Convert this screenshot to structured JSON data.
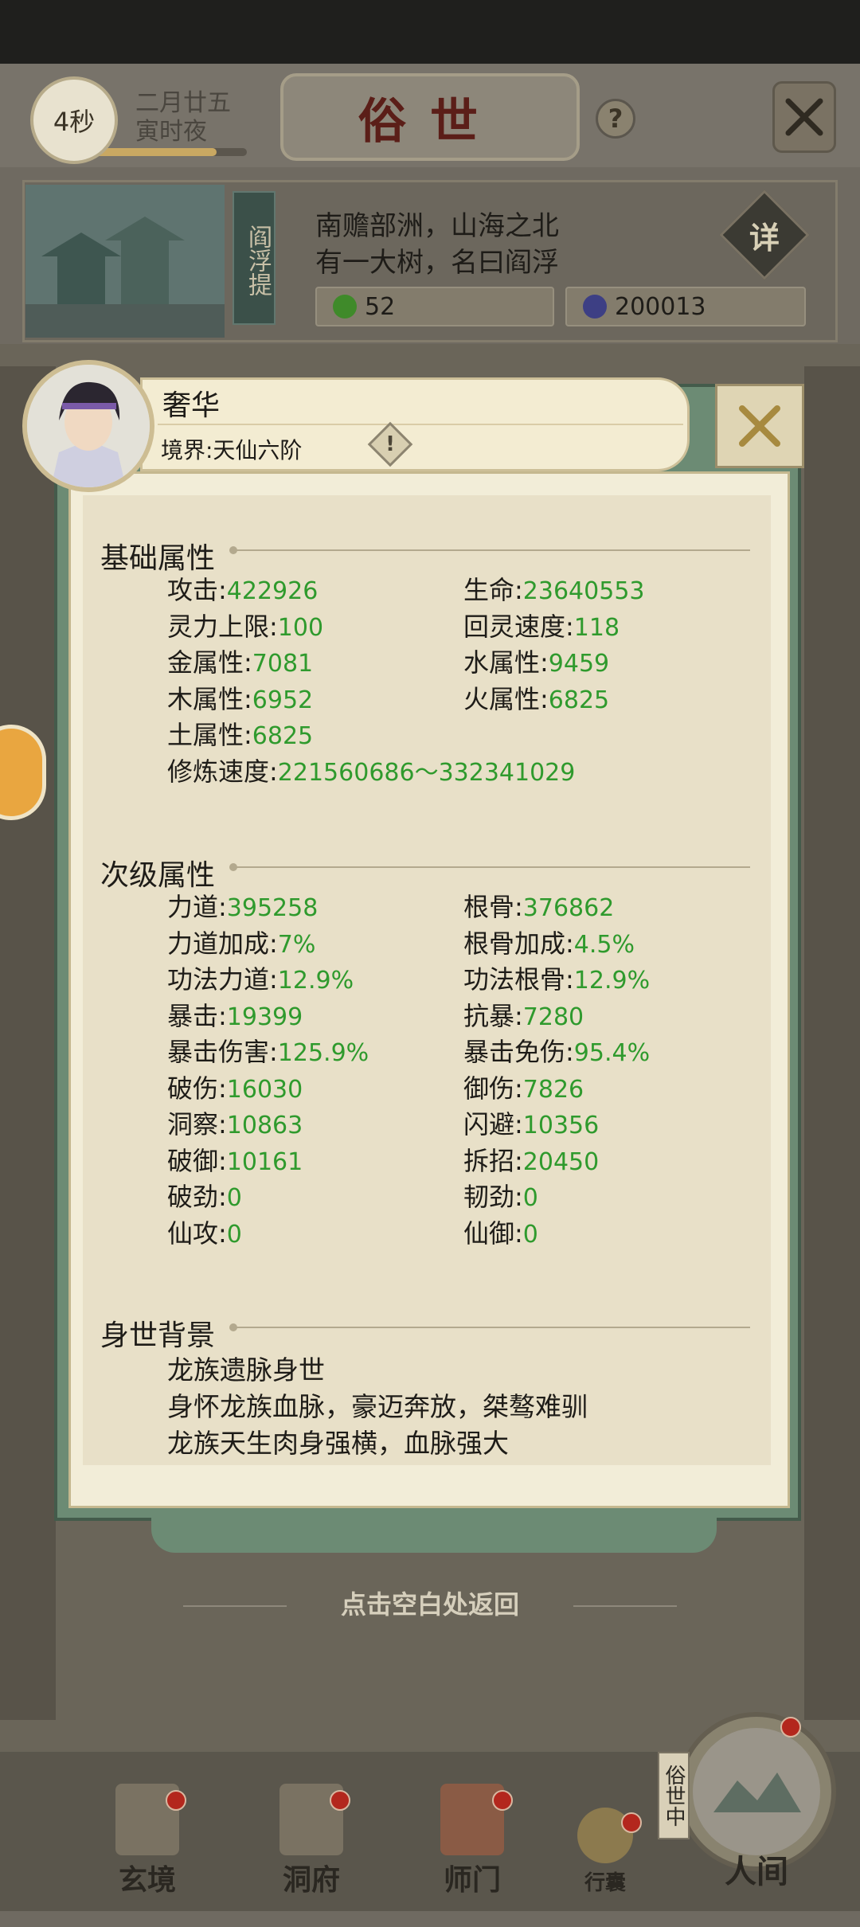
{
  "header": {
    "timer": "4秒",
    "date_line1": "二月廿五",
    "date_line2": "寅时夜",
    "progress": 0.8,
    "title": "俗世",
    "help_icon": "question-icon",
    "close_icon": "close-x-icon"
  },
  "location": {
    "banner": "阎浮提",
    "desc_line1": "南赡部洲，山海之北",
    "desc_line2": "有一大树，名曰阎浮",
    "detail_label": "详",
    "resource1": "52",
    "resource2": "200013"
  },
  "character": {
    "name": "奢华",
    "realm": "境界:天仙六阶"
  },
  "sections": {
    "basic_title": "基础属性",
    "secondary_title": "次级属性",
    "background_title": "身世背景"
  },
  "basic_attrs": [
    {
      "label": "攻击:",
      "value": "422926"
    },
    {
      "label": "生命:",
      "value": "23640553"
    },
    {
      "label": "灵力上限:",
      "value": "100"
    },
    {
      "label": "回灵速度:",
      "value": "118"
    },
    {
      "label": "金属性:",
      "value": "7081"
    },
    {
      "label": "水属性:",
      "value": "9459"
    },
    {
      "label": "木属性:",
      "value": "6952"
    },
    {
      "label": "火属性:",
      "value": "6825"
    },
    {
      "label": "土属性:",
      "value": "6825"
    },
    {
      "label": "修炼速度:",
      "value": "221560686～332341029"
    }
  ],
  "secondary_attrs": [
    {
      "label": "力道:",
      "value": "395258"
    },
    {
      "label": "根骨:",
      "value": "376862"
    },
    {
      "label": "力道加成:",
      "value": "7%"
    },
    {
      "label": "根骨加成:",
      "value": "4.5%"
    },
    {
      "label": "功法力道:",
      "value": "12.9%"
    },
    {
      "label": "功法根骨:",
      "value": "12.9%"
    },
    {
      "label": "暴击:",
      "value": "19399"
    },
    {
      "label": "抗暴:",
      "value": "7280"
    },
    {
      "label": "暴击伤害:",
      "value": "125.9%"
    },
    {
      "label": "暴击免伤:",
      "value": "95.4%"
    },
    {
      "label": "破伤:",
      "value": "16030"
    },
    {
      "label": "御伤:",
      "value": "7826"
    },
    {
      "label": "洞察:",
      "value": "10863"
    },
    {
      "label": "闪避:",
      "value": "10356"
    },
    {
      "label": "破御:",
      "value": "10161"
    },
    {
      "label": "拆招:",
      "value": "20450"
    },
    {
      "label": "破劲:",
      "value": "0"
    },
    {
      "label": "韧劲:",
      "value": "0"
    },
    {
      "label": "仙攻:",
      "value": "0"
    },
    {
      "label": "仙御:",
      "value": "0"
    }
  ],
  "background": [
    "龙族遗脉身世",
    "身怀龙族血脉，豪迈奔放，桀骜难驯",
    "龙族天生肉身强横，血脉强大"
  ],
  "return_hint": "点击空白处返回",
  "nav": {
    "items": [
      "玄境",
      "洞府",
      "师门",
      "行囊"
    ],
    "world_tag": "俗世中",
    "world_label": "人间"
  },
  "colors": {
    "value_green": "#2f9a2d",
    "title_red": "#5b1e18",
    "panel_green": "#6c8b74"
  }
}
